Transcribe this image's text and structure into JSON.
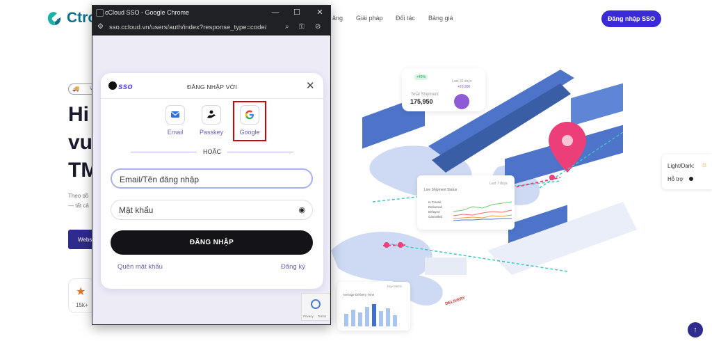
{
  "site": {
    "logo_text": "Ctro",
    "nav": [
      "ăng",
      "Giải pháp",
      "Đối tác",
      "Bảng giá"
    ],
    "sso_button": "Đăng nhập SSO",
    "hero_lines": [
      "Hi",
      "vu",
      "TM"
    ],
    "hero_small": [
      "Theo dõ",
      "— tất cả"
    ],
    "hero_button": "Webs",
    "hero_badge": "V",
    "stat_value": "15k+"
  },
  "illustration": {
    "card_badge": "+45%",
    "card_period": "Last 30 days",
    "card_delta": "+20,300",
    "card_label": "Total Shipment",
    "card_value": "175,950",
    "chart_title": "Live Shipment Status",
    "chart_period": "Last 7 days",
    "chart_legend": [
      "In Transit",
      "Delivered",
      "Delayed",
      "Cancelled"
    ],
    "delivery_label": "DELIVERY",
    "bar_title": "Average Delivery Time",
    "bar_sub": "Key Metric"
  },
  "side_widget": {
    "theme_label": "Light/Dark:",
    "support_label": "Hỗ trợ"
  },
  "chrome": {
    "window_title": "cCloud SSO - Google Chrome",
    "url": "sso.ccloud.vn/users/auth/index?response_type=code&cl..."
  },
  "login": {
    "logo_suffix": "sso",
    "heading": "ĐĂNG NHẬP VỚI",
    "providers": [
      {
        "label": "Email",
        "icon": "envelope-icon"
      },
      {
        "label": "Passkey",
        "icon": "passkey-icon"
      },
      {
        "label": "Google",
        "icon": "google-icon"
      }
    ],
    "or_text": "HOẶC",
    "email_placeholder": "Email/Tên đăng nhập",
    "password_placeholder": "Mật khẩu",
    "submit": "ĐĂNG NHẬP",
    "forgot": "Quên mật khẩu",
    "register": "Đăng ký"
  },
  "recaptcha": {
    "privacy": "Privacy",
    "terms": "Terms"
  },
  "colors": {
    "accent": "#3b2bd6",
    "button_dark": "#141418",
    "link": "#6b63b8",
    "highlight": "#d40000"
  }
}
